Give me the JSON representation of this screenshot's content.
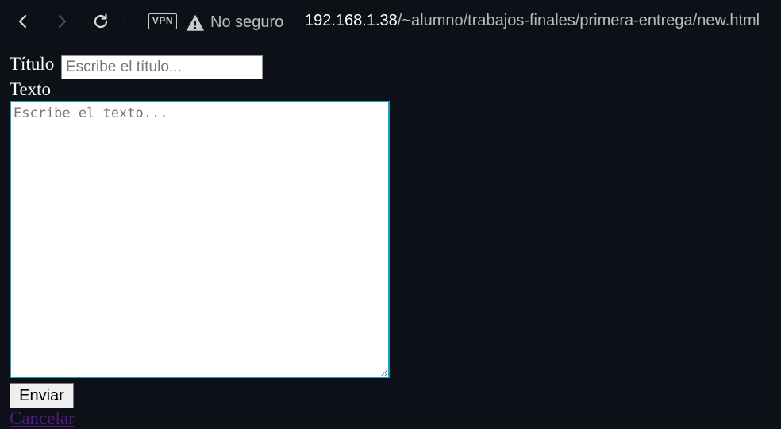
{
  "browser": {
    "vpn_badge": "VPN",
    "security_label": "No seguro",
    "url_host": "192.168.1.38",
    "url_path": "/~alumno/trabajos-finales/primera-entrega/new.html",
    "icons": {
      "back": "chevron-left-icon",
      "forward": "chevron-right-icon",
      "reload": "reload-icon",
      "warning": "warning-triangle-icon"
    }
  },
  "form": {
    "title_label": "Título",
    "title_placeholder": "Escribe el título...",
    "title_value": "",
    "text_label": "Texto",
    "text_placeholder": "Escribe el texto...",
    "text_value": "",
    "submit_label": "Enviar",
    "cancel_label": "Cancelar"
  },
  "colors": {
    "page_background": "#0e1017",
    "textarea_focus_border": "#1c9fc4",
    "visited_link": "#551a8b"
  }
}
